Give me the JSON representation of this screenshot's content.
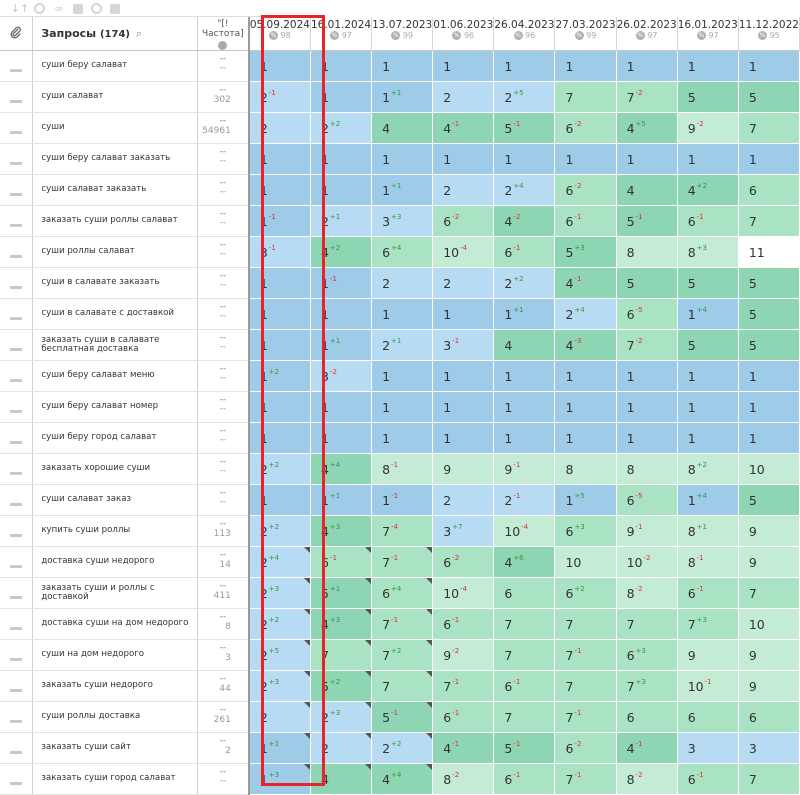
{
  "toolbar": {
    "tools": [
      "sort-icon",
      "coins-icon",
      "link-icon",
      "chart-icon",
      "contrast-icon",
      "export-icon"
    ]
  },
  "header": {
    "query_label": "Запросы",
    "query_count": "(174)",
    "freq_label": "\"[!Частота]",
    "dates": [
      {
        "date": "05.09.2024",
        "pct": "98"
      },
      {
        "date": "16.01.2024",
        "pct": "97"
      },
      {
        "date": "13.07.2023",
        "pct": "99"
      },
      {
        "date": "01.06.2023",
        "pct": "96"
      },
      {
        "date": "26.04.2023",
        "pct": "96"
      },
      {
        "date": "27.03.2023",
        "pct": "99"
      },
      {
        "date": "26.02.2023",
        "pct": "97"
      },
      {
        "date": "16.01.2023",
        "pct": "97"
      },
      {
        "date": "11.12.2022",
        "pct": "95"
      }
    ]
  },
  "colors": {
    "c1": "#9ecbe8",
    "c2": "#b7dbf3",
    "c3": "#8ed6b3",
    "c4": "#a9e3c4",
    "c5": "#c4ecd5",
    "c6": "#ffffff",
    "highlight_frame": "#e8232a"
  },
  "rows": [
    {
      "q": "суши беру салават",
      "f": "",
      "cells": [
        [
          "1",
          "",
          ""
        ],
        [
          "1",
          "",
          ""
        ],
        [
          "1",
          "",
          ""
        ],
        [
          "1",
          "",
          ""
        ],
        [
          "1",
          "",
          ""
        ],
        [
          "1",
          "",
          ""
        ],
        [
          "1",
          "",
          ""
        ],
        [
          "1",
          "",
          ""
        ],
        [
          "1",
          "",
          ""
        ]
      ]
    },
    {
      "q": "суши салават",
      "f": "302",
      "cells": [
        [
          "2",
          "-1",
          "down"
        ],
        [
          "1",
          "",
          ""
        ],
        [
          "1",
          "+1",
          "up"
        ],
        [
          "2",
          "",
          ""
        ],
        [
          "2",
          "+5",
          "up"
        ],
        [
          "7",
          "",
          ""
        ],
        [
          "7",
          "-2",
          "down"
        ],
        [
          "5",
          "",
          ""
        ],
        [
          "5",
          "",
          ""
        ]
      ]
    },
    {
      "q": "суши",
      "f": "54961",
      "cells": [
        [
          "2",
          "",
          ""
        ],
        [
          "2",
          "+2",
          "up"
        ],
        [
          "4",
          "",
          ""
        ],
        [
          "4",
          "-1",
          "down"
        ],
        [
          "5",
          "-1",
          "down"
        ],
        [
          "6",
          "-2",
          "down"
        ],
        [
          "4",
          "+5",
          "up"
        ],
        [
          "9",
          "-2",
          "down"
        ],
        [
          "7",
          "",
          ""
        ]
      ]
    },
    {
      "q": "суши беру салават заказать",
      "f": "",
      "cells": [
        [
          "1",
          "",
          ""
        ],
        [
          "1",
          "",
          ""
        ],
        [
          "1",
          "",
          ""
        ],
        [
          "1",
          "",
          ""
        ],
        [
          "1",
          "",
          ""
        ],
        [
          "1",
          "",
          ""
        ],
        [
          "1",
          "",
          ""
        ],
        [
          "1",
          "",
          ""
        ],
        [
          "1",
          "",
          ""
        ]
      ]
    },
    {
      "q": "суши салават заказать",
      "f": "",
      "cells": [
        [
          "1",
          "",
          ""
        ],
        [
          "1",
          "",
          ""
        ],
        [
          "1",
          "+1",
          "up"
        ],
        [
          "2",
          "",
          ""
        ],
        [
          "2",
          "+4",
          "up"
        ],
        [
          "6",
          "-2",
          "down"
        ],
        [
          "4",
          "",
          ""
        ],
        [
          "4",
          "+2",
          "up"
        ],
        [
          "6",
          "",
          ""
        ]
      ]
    },
    {
      "q": "заказать суши роллы салават",
      "f": "",
      "cells": [
        [
          "1",
          "-1",
          "down"
        ],
        [
          "2",
          "+1",
          "up"
        ],
        [
          "3",
          "+3",
          "up"
        ],
        [
          "6",
          "-2",
          "down"
        ],
        [
          "4",
          "-2",
          "down"
        ],
        [
          "6",
          "-1",
          "down"
        ],
        [
          "5",
          "-1",
          "down"
        ],
        [
          "6",
          "-1",
          "down"
        ],
        [
          "7",
          "",
          ""
        ]
      ]
    },
    {
      "q": "суши роллы салават",
      "f": "",
      "cells": [
        [
          "3",
          "-1",
          "down"
        ],
        [
          "4",
          "+2",
          "up"
        ],
        [
          "6",
          "+4",
          "up"
        ],
        [
          "10",
          "-4",
          "down"
        ],
        [
          "6",
          "-1",
          "down"
        ],
        [
          "5",
          "+3",
          "up"
        ],
        [
          "8",
          "",
          ""
        ],
        [
          "8",
          "+3",
          "up"
        ],
        [
          "11",
          "",
          ""
        ]
      ]
    },
    {
      "q": "суши в салавате заказать",
      "f": "",
      "cells": [
        [
          "1",
          "",
          ""
        ],
        [
          "1",
          "-1",
          "down"
        ],
        [
          "2",
          "",
          ""
        ],
        [
          "2",
          "",
          ""
        ],
        [
          "2",
          "+2",
          "up"
        ],
        [
          "4",
          "-1",
          "down"
        ],
        [
          "5",
          "",
          ""
        ],
        [
          "5",
          "",
          ""
        ],
        [
          "5",
          "",
          ""
        ]
      ]
    },
    {
      "q": "суши в салавате с доставкой",
      "f": "",
      "cells": [
        [
          "1",
          "",
          ""
        ],
        [
          "1",
          "",
          ""
        ],
        [
          "1",
          "",
          ""
        ],
        [
          "1",
          "",
          ""
        ],
        [
          "1",
          "+1",
          "up"
        ],
        [
          "2",
          "+4",
          "up"
        ],
        [
          "6",
          "-5",
          "down"
        ],
        [
          "1",
          "+4",
          "up"
        ],
        [
          "5",
          "",
          ""
        ]
      ]
    },
    {
      "q": "заказать суши в салавате бесплатная доставка",
      "f": "",
      "cells": [
        [
          "1",
          "",
          ""
        ],
        [
          "1",
          "+1",
          "up"
        ],
        [
          "2",
          "+1",
          "up"
        ],
        [
          "3",
          "-1",
          "down"
        ],
        [
          "4",
          "",
          ""
        ],
        [
          "4",
          "-3",
          "down"
        ],
        [
          "7",
          "-2",
          "down"
        ],
        [
          "5",
          "",
          ""
        ],
        [
          "5",
          "",
          ""
        ]
      ]
    },
    {
      "q": "суши беру салават меню",
      "f": "",
      "cells": [
        [
          "1",
          "+2",
          "up"
        ],
        [
          "3",
          "-2",
          "down"
        ],
        [
          "1",
          "",
          ""
        ],
        [
          "1",
          "",
          ""
        ],
        [
          "1",
          "",
          ""
        ],
        [
          "1",
          "",
          ""
        ],
        [
          "1",
          "",
          ""
        ],
        [
          "1",
          "",
          ""
        ],
        [
          "1",
          "",
          ""
        ]
      ]
    },
    {
      "q": "суши беру салават номер",
      "f": "",
      "cells": [
        [
          "1",
          "",
          ""
        ],
        [
          "1",
          "",
          ""
        ],
        [
          "1",
          "",
          ""
        ],
        [
          "1",
          "",
          ""
        ],
        [
          "1",
          "",
          ""
        ],
        [
          "1",
          "",
          ""
        ],
        [
          "1",
          "",
          ""
        ],
        [
          "1",
          "",
          ""
        ],
        [
          "1",
          "",
          ""
        ]
      ]
    },
    {
      "q": "суши беру город салават",
      "f": "",
      "cells": [
        [
          "1",
          "",
          ""
        ],
        [
          "1",
          "",
          ""
        ],
        [
          "1",
          "",
          ""
        ],
        [
          "1",
          "",
          ""
        ],
        [
          "1",
          "",
          ""
        ],
        [
          "1",
          "",
          ""
        ],
        [
          "1",
          "",
          ""
        ],
        [
          "1",
          "",
          ""
        ],
        [
          "1",
          "",
          ""
        ]
      ]
    },
    {
      "q": "заказать хорошие суши",
      "f": "",
      "cells": [
        [
          "2",
          "+2",
          "up"
        ],
        [
          "4",
          "+4",
          "up"
        ],
        [
          "8",
          "-1",
          "down"
        ],
        [
          "9",
          "",
          ""
        ],
        [
          "9",
          "-1",
          "down"
        ],
        [
          "8",
          "",
          ""
        ],
        [
          "8",
          "",
          ""
        ],
        [
          "8",
          "+2",
          "up"
        ],
        [
          "10",
          "",
          ""
        ]
      ]
    },
    {
      "q": "суши салават заказ",
      "f": "",
      "cells": [
        [
          "1",
          "",
          ""
        ],
        [
          "1",
          "+1",
          "up"
        ],
        [
          "1",
          "-1",
          "down"
        ],
        [
          "2",
          "",
          ""
        ],
        [
          "2",
          "-1",
          "down"
        ],
        [
          "1",
          "+5",
          "up"
        ],
        [
          "6",
          "-5",
          "down"
        ],
        [
          "1",
          "+4",
          "up"
        ],
        [
          "5",
          "",
          ""
        ]
      ]
    },
    {
      "q": "купить суши роллы",
      "f": "113",
      "cells": [
        [
          "2",
          "+2",
          "up"
        ],
        [
          "4",
          "+3",
          "up"
        ],
        [
          "7",
          "-4",
          "down"
        ],
        [
          "3",
          "+7",
          "up"
        ],
        [
          "10",
          "-4",
          "down"
        ],
        [
          "6",
          "+3",
          "up"
        ],
        [
          "9",
          "-1",
          "down"
        ],
        [
          "8",
          "+1",
          "up"
        ],
        [
          "9",
          "",
          ""
        ]
      ]
    },
    {
      "q": "доставка суши недорого",
      "f": "14",
      "cells": [
        [
          "2",
          "+4",
          "up"
        ],
        [
          "6",
          "-1",
          "down"
        ],
        [
          "7",
          "-1",
          "down"
        ],
        [
          "6",
          "-2",
          "down"
        ],
        [
          "4",
          "+6",
          "up"
        ],
        [
          "10",
          "",
          ""
        ],
        [
          "10",
          "-2",
          "down"
        ],
        [
          "8",
          "-1",
          "down"
        ],
        [
          "9",
          "",
          ""
        ]
      ]
    },
    {
      "q": "заказать суши и роллы с доставкой",
      "f": "411",
      "cells": [
        [
          "2",
          "+3",
          "up"
        ],
        [
          "5",
          "+1",
          "up"
        ],
        [
          "6",
          "+4",
          "up"
        ],
        [
          "10",
          "-4",
          "down"
        ],
        [
          "6",
          "",
          ""
        ],
        [
          "6",
          "+2",
          "up"
        ],
        [
          "8",
          "-2",
          "down"
        ],
        [
          "6",
          "-1",
          "down"
        ],
        [
          "7",
          "",
          ""
        ]
      ]
    },
    {
      "q": "доставка суши на дом недорого",
      "f": "8",
      "cells": [
        [
          "2",
          "+2",
          "up"
        ],
        [
          "4",
          "+3",
          "up"
        ],
        [
          "7",
          "-1",
          "down"
        ],
        [
          "6",
          "-1",
          "down"
        ],
        [
          "7",
          "",
          ""
        ],
        [
          "7",
          "",
          ""
        ],
        [
          "7",
          "",
          ""
        ],
        [
          "7",
          "+3",
          "up"
        ],
        [
          "10",
          "",
          ""
        ]
      ]
    },
    {
      "q": "суши на дом недорого",
      "f": "3",
      "cells": [
        [
          "2",
          "+5",
          "up"
        ],
        [
          "7",
          "",
          ""
        ],
        [
          "7",
          "+2",
          "up"
        ],
        [
          "9",
          "-2",
          "down"
        ],
        [
          "7",
          "",
          ""
        ],
        [
          "7",
          "-1",
          "down"
        ],
        [
          "6",
          "+3",
          "up"
        ],
        [
          "9",
          "",
          ""
        ],
        [
          "9",
          "",
          ""
        ]
      ]
    },
    {
      "q": "заказать суши недорого",
      "f": "44",
      "cells": [
        [
          "2",
          "+3",
          "up"
        ],
        [
          "5",
          "+2",
          "up"
        ],
        [
          "7",
          "",
          ""
        ],
        [
          "7",
          "-1",
          "down"
        ],
        [
          "6",
          "-1",
          "down"
        ],
        [
          "7",
          "",
          ""
        ],
        [
          "7",
          "+3",
          "up"
        ],
        [
          "10",
          "-1",
          "down"
        ],
        [
          "9",
          "",
          ""
        ]
      ]
    },
    {
      "q": "суши роллы доставка",
      "f": "261",
      "cells": [
        [
          "2",
          "",
          ""
        ],
        [
          "2",
          "+3",
          "up"
        ],
        [
          "5",
          "-1",
          "down"
        ],
        [
          "6",
          "-1",
          "down"
        ],
        [
          "7",
          "",
          ""
        ],
        [
          "7",
          "-1",
          "down"
        ],
        [
          "6",
          "",
          ""
        ],
        [
          "6",
          "",
          ""
        ],
        [
          "6",
          "",
          ""
        ]
      ]
    },
    {
      "q": "заказать суши сайт",
      "f": "2",
      "cells": [
        [
          "1",
          "+1",
          "up"
        ],
        [
          "2",
          "",
          ""
        ],
        [
          "2",
          "+2",
          "up"
        ],
        [
          "4",
          "-1",
          "down"
        ],
        [
          "5",
          "-1",
          "down"
        ],
        [
          "6",
          "-2",
          "down"
        ],
        [
          "4",
          "-1",
          "down"
        ],
        [
          "3",
          "",
          ""
        ],
        [
          "3",
          "",
          ""
        ]
      ]
    },
    {
      "q": "заказать суши город салават",
      "f": "",
      "cells": [
        [
          "1",
          "+3",
          "up"
        ],
        [
          "4",
          "",
          ""
        ],
        [
          "4",
          "+4",
          "up"
        ],
        [
          "8",
          "-2",
          "down"
        ],
        [
          "6",
          "-1",
          "down"
        ],
        [
          "7",
          "-1",
          "down"
        ],
        [
          "8",
          "-2",
          "down"
        ],
        [
          "6",
          "-1",
          "down"
        ],
        [
          "7",
          "",
          ""
        ]
      ]
    }
  ]
}
